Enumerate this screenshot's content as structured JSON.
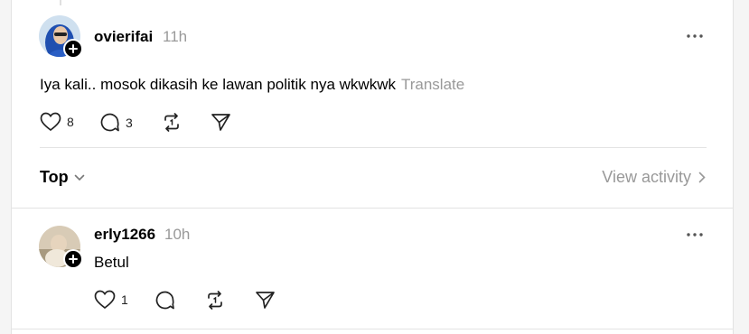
{
  "post": {
    "username": "ovierifai",
    "time": "11h",
    "text": "Iya kali.. mosok dikasih ke lawan politik nya wkwkwk",
    "translate_label": "Translate",
    "likes": "8",
    "replies": "3"
  },
  "replies_header": {
    "sort_label": "Top",
    "view_activity_label": "View activity"
  },
  "reply": {
    "username": "erly1266",
    "time": "10h",
    "text": "Betul",
    "likes": "1"
  },
  "colors": {
    "muted_text": "#999999",
    "divider": "#e3e3e3",
    "badge": "#000000"
  }
}
